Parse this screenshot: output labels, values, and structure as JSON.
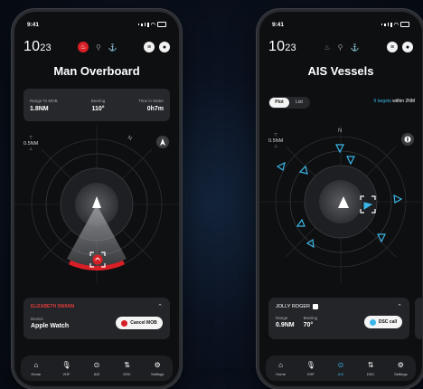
{
  "left_screen": {
    "status_time": "9:41",
    "clock": {
      "hour": "10",
      "minute": "23"
    },
    "title": "Man Overboard",
    "stats": [
      {
        "label": "Range To MOB",
        "value": "1.8NM"
      },
      {
        "label": "Bearing",
        "value": "110°"
      },
      {
        "label": "Time in Water",
        "value": "0h7m"
      }
    ],
    "range_label": "0.5NM",
    "north_label": "N",
    "alert": {
      "name": "ELIZABETH SWANN",
      "device_label": "Device",
      "device_value": "Apple Watch",
      "cancel_label": "Cancel MOB"
    }
  },
  "right_screen": {
    "status_time": "9:41",
    "clock": {
      "hour": "10",
      "minute": "23"
    },
    "title": "AIS Vessels",
    "view_toggle": {
      "plot": "Plot",
      "list": "List"
    },
    "targets_count": "9 targets",
    "targets_suffix": "within 2NM",
    "range_label": "0.5NM",
    "north_label": "N",
    "vessel": {
      "name": "JOLLY ROGER",
      "range_label": "Range",
      "range_value": "0.9NM",
      "bearing_label": "Bearing",
      "bearing_value": "70°",
      "dsc_label": "DSC call"
    }
  },
  "tabs": [
    {
      "label": "Home",
      "icon": "home-icon"
    },
    {
      "label": "VHF",
      "icon": "microphone-icon"
    },
    {
      "label": "AIS",
      "icon": "location-pin-icon"
    },
    {
      "label": "DSC",
      "icon": "arrows-icon"
    },
    {
      "label": "Settings",
      "icon": "gear-icon"
    }
  ],
  "colors": {
    "alert_red": "#d81f26",
    "accent_blue": "#3ab7e8",
    "screen_bg": "#0e0f11"
  }
}
